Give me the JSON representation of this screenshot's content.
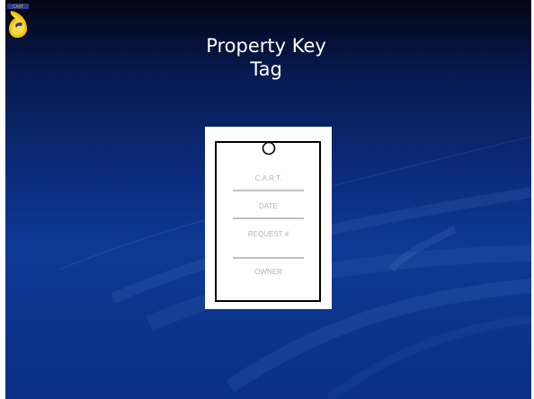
{
  "slide": {
    "title_line1": "Property Key",
    "title_line2": "Tag",
    "logo_text": "CART",
    "background_color": "#0b2f83"
  },
  "tag": {
    "fields": [
      "C.A.R.T.",
      "DATE",
      "REQUEST #",
      "OWNER"
    ],
    "field_text_color": "#b3b3b3"
  }
}
